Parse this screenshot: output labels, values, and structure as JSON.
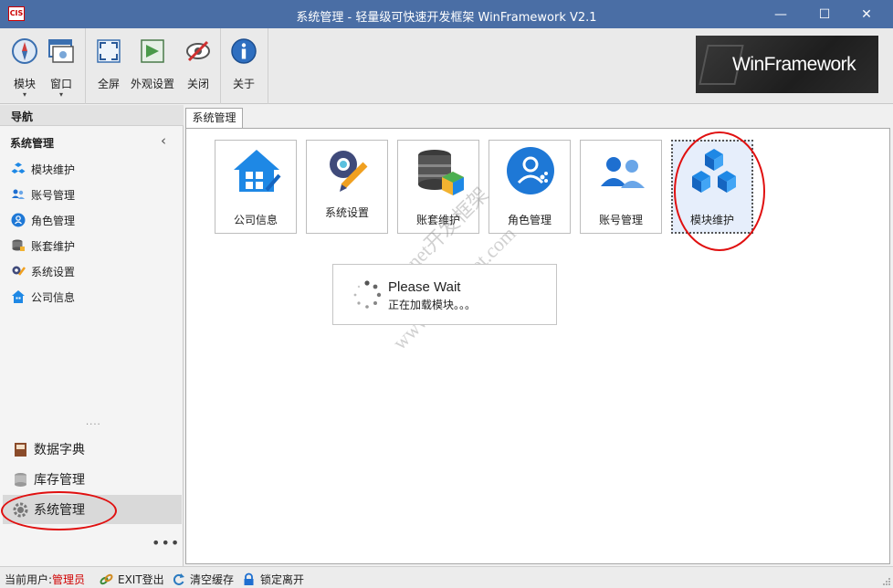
{
  "window": {
    "title": "系统管理 - 轻量级可快速开发框架 WinFramework V2.1",
    "app_icon_text": "CIS",
    "minimize": "—",
    "maximize": "☐",
    "close": "✕"
  },
  "ribbon": {
    "buttons": [
      {
        "label": "模块",
        "dropdown": "▾"
      },
      {
        "label": "窗口",
        "dropdown": "▾"
      },
      {
        "label": "全屏"
      },
      {
        "label": "外观设置"
      },
      {
        "label": "关闭"
      },
      {
        "label": "关于"
      }
    ],
    "logo_text": "WinFramework"
  },
  "nav": {
    "header": "导航",
    "group_title": "系统管理",
    "collapse": "‹",
    "items": [
      {
        "label": "模块维护"
      },
      {
        "label": "账号管理"
      },
      {
        "label": "角色管理"
      },
      {
        "label": "账套维护"
      },
      {
        "label": "系统设置"
      },
      {
        "label": "公司信息"
      }
    ],
    "splitter_dots": "····",
    "bottom_items": [
      {
        "label": "数据字典"
      },
      {
        "label": "库存管理"
      },
      {
        "label": "系统管理"
      }
    ],
    "more": "•••"
  },
  "main": {
    "tab_label": "系统管理",
    "tiles": [
      {
        "label": "公司信息"
      },
      {
        "label": "系统设置"
      },
      {
        "label": "账套维护"
      },
      {
        "label": "角色管理"
      },
      {
        "label": "账号管理"
      },
      {
        "label": "模块维护"
      }
    ],
    "wait": {
      "title": "Please Wait",
      "subtitle": "正在加载模块。。。"
    },
    "watermark": {
      "line1": "YES dot net开发框架",
      "line2": "www.yesdotnet.com"
    }
  },
  "statusbar": {
    "current_user_label": "当前用户:",
    "current_user": "管理员",
    "exit": "EXIT登出",
    "clear_cache": "清空缓存",
    "lock": "锁定离开"
  },
  "colors": {
    "titlebar": "#4a6ea5",
    "accent_blue": "#1e7ad6",
    "annotation_red": "#e01010"
  }
}
